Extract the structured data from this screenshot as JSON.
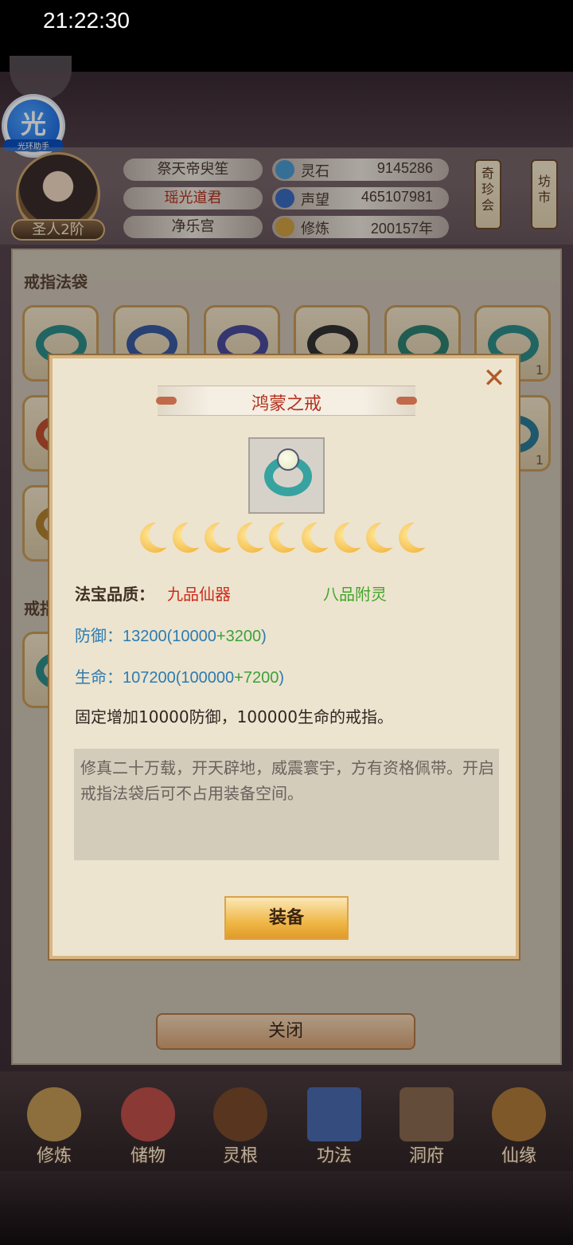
{
  "status_bar": {
    "time": "21:22:30"
  },
  "assistant": {
    "char": "光",
    "label": "光环助手"
  },
  "player": {
    "rank": "圣人2阶",
    "title": "祭天帝臾笙",
    "name": "瑶光道君",
    "sect": "净乐宫",
    "stats": [
      {
        "label": "灵石",
        "value": "9145286",
        "icon": "spirit-stone-icon",
        "color": "#4a9ad0"
      },
      {
        "label": "声望",
        "value": "465107981",
        "icon": "prestige-icon",
        "color": "#3a6ac0"
      },
      {
        "label": "修炼",
        "value": "200157年",
        "icon": "cultivation-icon",
        "color": "#d0a040"
      }
    ]
  },
  "header_buttons": [
    {
      "label": "奇\n珍\n会"
    },
    {
      "label": "坊\n市"
    }
  ],
  "panel": {
    "section1_title": "戒指法袋",
    "section2_title": "戒指",
    "slot_counts": [
      "1",
      "1"
    ],
    "close_label": "关闭"
  },
  "modal": {
    "title": "鸿蒙之戒",
    "stars": 9,
    "quality_label": "法宝品质：",
    "quality_value": "九品仙器",
    "enchant_value": "八品附灵",
    "defense_prefix": "防御：13200(10000",
    "defense_bonus": "+3200",
    "defense_suffix": ")",
    "life_prefix": "生命：107200(100000",
    "life_bonus": "+7200",
    "life_suffix": ")",
    "description": "固定增加10000防御，100000生命的戒指。",
    "lore": "修真二十万载，开天辟地，威震寰宇，方有资格佩带。开启戒指法袋后可不占用装备空间。",
    "equip_label": "装备",
    "close_symbol": "✕"
  },
  "nav": [
    {
      "label": "修炼",
      "icon": "meditation-icon",
      "color": "#c49a55"
    },
    {
      "label": "储物",
      "icon": "storage-bag-icon",
      "color": "#c0504a"
    },
    {
      "label": "灵根",
      "icon": "spirit-root-icon",
      "color": "#7a4a2a"
    },
    {
      "label": "功法",
      "icon": "scripture-book-icon",
      "color": "#4a6ab0"
    },
    {
      "label": "洞府",
      "icon": "cave-dwelling-icon",
      "color": "#8a6a50"
    },
    {
      "label": "仙缘",
      "icon": "immortal-fate-icon",
      "color": "#b07a3a"
    }
  ]
}
